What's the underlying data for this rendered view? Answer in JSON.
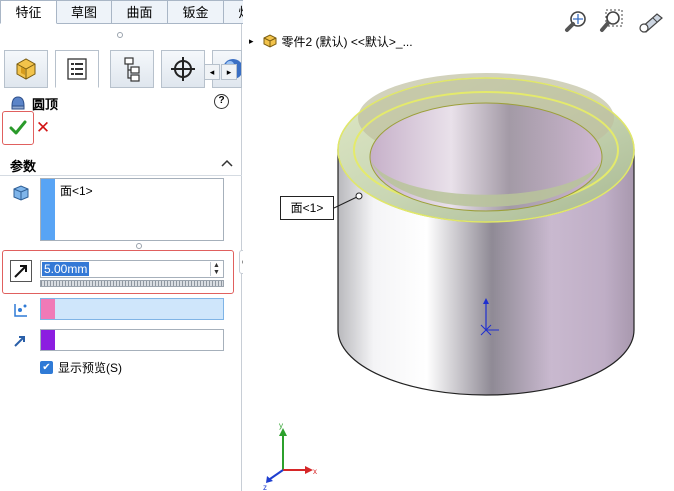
{
  "tabs": [
    {
      "label": "特征",
      "active": true
    },
    {
      "label": "草图",
      "active": false
    },
    {
      "label": "曲面",
      "active": false
    },
    {
      "label": "钣金",
      "active": false
    },
    {
      "label": "焊件",
      "active": false
    }
  ],
  "panel": {
    "icons": [
      "feature-manager-icon",
      "property-manager-icon",
      "configuration-manager-icon",
      "dimxpert-icon"
    ],
    "scroll_left": "◂",
    "scroll_right": "▸",
    "title": "圆顶",
    "help": "?",
    "ok": "✔",
    "cancel": "✕",
    "section_label": "参数",
    "section_toggle": "⌃",
    "faces_item": "面<1>",
    "distance_value": "5.00mm",
    "spin_up": "▲",
    "spin_down": "▼",
    "show_preview_label": "显示预览(S)",
    "show_preview_checked": true,
    "colors": {
      "face_stripe": "#58a4f5",
      "point_stripe": "#f07ab7",
      "direction_stripe": "#8c1de0",
      "accent": "#e0605e"
    }
  },
  "viewport": {
    "breadcrumb_arrow": "▸",
    "breadcrumb": "零件2 (默认) <<默认>_...",
    "callout": "面<1>",
    "triad": {
      "x": "x",
      "y": "y",
      "z": "z"
    }
  }
}
